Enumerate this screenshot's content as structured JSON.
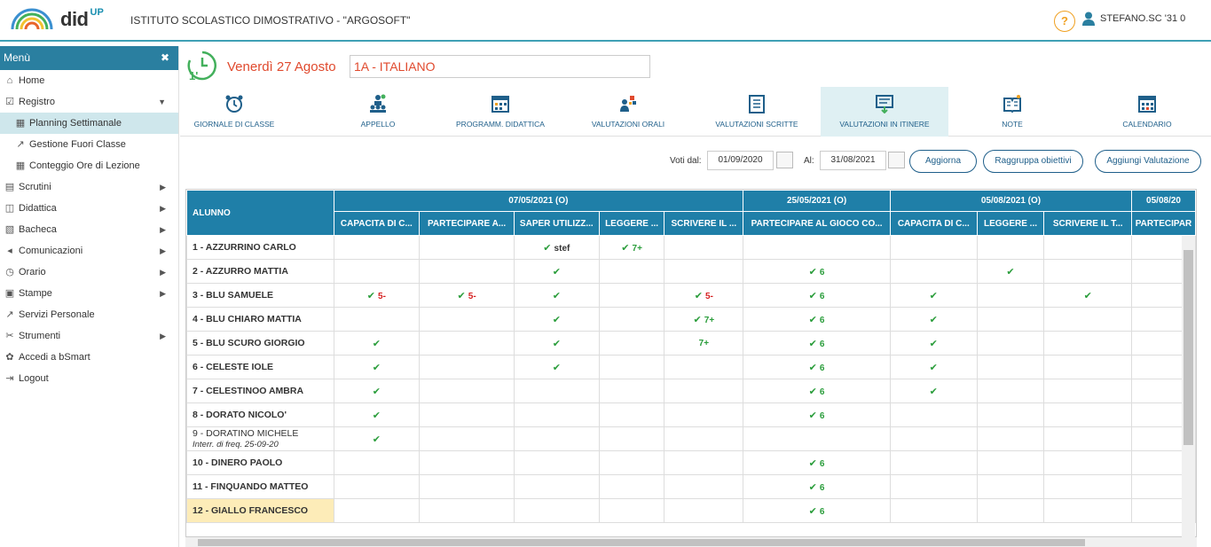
{
  "app": {
    "logo_text": "did",
    "logo_sup": "UP",
    "school": "ISTITUTO SCOLASTICO DIMOSTRATIVO - \"ARGOSOFT\"",
    "help": "?",
    "user": "STEFANO.SC  '31  0"
  },
  "sidebar": {
    "title": "Menù",
    "close": "✖",
    "items": [
      {
        "label": "Home",
        "icon": "⌂"
      },
      {
        "label": "Registro",
        "icon": "☑"
      },
      {
        "label": "Planning Settimanale",
        "icon": "▦"
      },
      {
        "label": "Gestione Fuori Classe",
        "icon": "↗"
      },
      {
        "label": "Conteggio Ore di Lezione",
        "icon": "▦"
      },
      {
        "label": "Scrutini",
        "icon": "▤"
      },
      {
        "label": "Didattica",
        "icon": "◫"
      },
      {
        "label": "Bacheca",
        "icon": "▧"
      },
      {
        "label": "Comunicazioni",
        "icon": "◂"
      },
      {
        "label": "Orario",
        "icon": "◷"
      },
      {
        "label": "Stampe",
        "icon": "▣"
      },
      {
        "label": "Servizi Personale",
        "icon": "↗"
      },
      {
        "label": "Strumenti",
        "icon": "✂"
      },
      {
        "label": "Accedi a bSmart",
        "icon": "✿"
      },
      {
        "label": "Logout",
        "icon": "⇥"
      }
    ]
  },
  "main": {
    "day_badge": "1'",
    "day": "Venerdì 27 Agosto",
    "class": "1A - ITALIANO"
  },
  "tabs": [
    {
      "label": "GIORNALE DI CLASSE",
      "icon": "alarm-clock-icon"
    },
    {
      "label": "APPELLO",
      "icon": "students-icon"
    },
    {
      "label": "PROGRAMM. DIDATTICA",
      "icon": "planner-icon"
    },
    {
      "label": "VALUTAZIONI ORALI",
      "icon": "oral-grades-icon"
    },
    {
      "label": "VALUTAZIONI SCRITTE",
      "icon": "written-grades-icon"
    },
    {
      "label": "VALUTAZIONI IN ITINERE",
      "icon": "ongoing-grades-icon"
    },
    {
      "label": "NOTE",
      "icon": "notes-icon"
    },
    {
      "label": "CALENDARIO",
      "icon": "calendar-icon"
    }
  ],
  "filters": {
    "from_label": "Voti dal:",
    "from_value": "01/09/2020",
    "to_label": "Al:",
    "to_value": "31/08/2021",
    "btn_update": "Aggiorna",
    "btn_group": "Raggruppa obiettivi",
    "btn_add": "Aggiungi Valutazione"
  },
  "table": {
    "student_header": "ALUNNO",
    "date_groups": [
      {
        "label": "07/05/2021 (O)",
        "span": 5
      },
      {
        "label": "25/05/2021 (O)",
        "span": 1
      },
      {
        "label": "05/08/2021 (O)",
        "span": 3
      },
      {
        "label": "05/08/20",
        "span": 1
      }
    ],
    "objectives": [
      "CAPACITA DI C...",
      "PARTECIPARE A...",
      "SAPER UTILIZZ...",
      "LEGGERE ...",
      "SCRIVERE IL ...",
      "PARTECIPARE AL GIOCO CO...",
      "CAPACITA DI C...",
      "LEGGERE ...",
      "SCRIVERE IL T...",
      "PARTECIPAR"
    ],
    "rows": [
      {
        "name": "1 - AZZURRINO CARLO",
        "cells": [
          null,
          null,
          {
            "c": true,
            "g": "stef",
            "cls": "dark"
          },
          {
            "c": true,
            "g": "7+",
            "cls": "grn"
          },
          null,
          null,
          null,
          null,
          null,
          null
        ]
      },
      {
        "name": "2 - AZZURRO MATTIA",
        "cells": [
          null,
          null,
          {
            "c": true
          },
          null,
          null,
          {
            "c": true,
            "g": "6",
            "cls": "grn"
          },
          null,
          {
            "c": true
          },
          null,
          null
        ]
      },
      {
        "name": "3 - BLU SAMUELE",
        "cells": [
          {
            "c": true,
            "g": "5-",
            "cls": "red"
          },
          {
            "c": true,
            "g": "5-",
            "cls": "red"
          },
          {
            "c": true
          },
          null,
          {
            "c": true,
            "g": "5-",
            "cls": "red"
          },
          {
            "c": true,
            "g": "6",
            "cls": "grn"
          },
          {
            "c": true
          },
          null,
          {
            "c": true
          },
          null
        ]
      },
      {
        "name": "4 - BLU CHIARO MATTIA",
        "cells": [
          null,
          null,
          {
            "c": true
          },
          null,
          {
            "c": true,
            "g": "7+",
            "cls": "grn"
          },
          {
            "c": true,
            "g": "6",
            "cls": "grn"
          },
          {
            "c": true
          },
          null,
          null,
          null
        ]
      },
      {
        "name": "5 - BLU SCURO GIORGIO",
        "cells": [
          {
            "c": true
          },
          null,
          {
            "c": true
          },
          null,
          {
            "c": false,
            "g": "7+",
            "cls": "grn"
          },
          {
            "c": true,
            "g": "6",
            "cls": "grn"
          },
          {
            "c": true
          },
          null,
          null,
          null
        ]
      },
      {
        "name": "6 - CELESTE IOLE",
        "cells": [
          {
            "c": true
          },
          null,
          {
            "c": true
          },
          null,
          null,
          {
            "c": true,
            "g": "6",
            "cls": "grn"
          },
          {
            "c": true
          },
          null,
          null,
          null
        ]
      },
      {
        "name": "7 - CELESTINOO AMBRA",
        "cells": [
          {
            "c": true
          },
          null,
          null,
          null,
          null,
          {
            "c": true,
            "g": "6",
            "cls": "grn"
          },
          {
            "c": true
          },
          null,
          null,
          null
        ]
      },
      {
        "name": "8 - DORATO NICOLO'",
        "cells": [
          {
            "c": true
          },
          null,
          null,
          null,
          null,
          {
            "c": true,
            "g": "6",
            "cls": "grn"
          },
          null,
          null,
          null,
          null
        ]
      },
      {
        "name": "9 - DORATINO MICHELE",
        "note": "Interr. di freq. 25-09-20",
        "cells": [
          {
            "c": true
          },
          null,
          null,
          null,
          null,
          null,
          null,
          null,
          null,
          null
        ]
      },
      {
        "name": "10 - DINERO PAOLO",
        "cells": [
          null,
          null,
          null,
          null,
          null,
          {
            "c": true,
            "g": "6",
            "cls": "grn"
          },
          null,
          null,
          null,
          null
        ]
      },
      {
        "name": "11 - FINQUANDO MATTEO",
        "cells": [
          null,
          null,
          null,
          null,
          null,
          {
            "c": true,
            "g": "6",
            "cls": "grn"
          },
          null,
          null,
          null,
          null
        ]
      },
      {
        "name": "12 - GIALLO FRANCESCO",
        "highlight": true,
        "cells": [
          null,
          null,
          null,
          null,
          null,
          {
            "c": true,
            "g": "6",
            "cls": "grn"
          },
          null,
          null,
          null,
          null
        ]
      }
    ]
  }
}
